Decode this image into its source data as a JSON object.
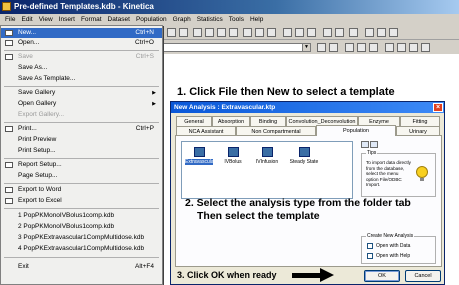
{
  "window": {
    "title": "Pre-defined Templates.kdb - Kinetica"
  },
  "menubar": [
    "File",
    "Edit",
    "View",
    "Insert",
    "Format",
    "Dataset",
    "Population",
    "Graph",
    "Statistics",
    "Tools",
    "Help"
  ],
  "file_menu": {
    "items": [
      {
        "label": "New...",
        "shortcut": "Ctrl+N",
        "selected": true
      },
      {
        "label": "Open...",
        "shortcut": "Ctrl+O"
      },
      {
        "label": "Save",
        "shortcut": "Ctrl+S",
        "disabled": true
      },
      {
        "label": "Save As..."
      },
      {
        "label": "Save As Template..."
      },
      {
        "label": "Save Gallery",
        "submenu": true
      },
      {
        "label": "Open Gallery",
        "submenu": true
      },
      {
        "label": "Export Gallery...",
        "disabled": true
      },
      {
        "label": "Print...",
        "shortcut": "Ctrl+P"
      },
      {
        "label": "Print Preview"
      },
      {
        "label": "Print Setup..."
      },
      {
        "label": "Report Setup..."
      },
      {
        "label": "Page Setup..."
      },
      {
        "label": "Export to Word"
      },
      {
        "label": "Export to Excel"
      },
      {
        "label": "1 PopPKMonoIVBolus1comp.kdb"
      },
      {
        "label": "2 PopPKMonoIVBolus1comp.kdb"
      },
      {
        "label": "3 PopPKExtravascular1CompMultidose.kdb"
      },
      {
        "label": "4 PopPKExtravascular1CompMultidose.kdb"
      },
      {
        "label": "Exit",
        "shortcut": "Alt+F4"
      }
    ]
  },
  "annotations": {
    "step1": "1. Click File then New to select a template",
    "step2_line1": "2. Select the analysis type from the folder tab",
    "step2_line2": "Then select the template",
    "step3": "3. Click OK when ready"
  },
  "dialog": {
    "title": "New Analysis : Extravascular.ktp",
    "tabs_row1": [
      "General",
      "Absorption",
      "Binding",
      "Convolution_Deconvolution",
      "Enzyme",
      "Fitting"
    ],
    "tabs_row2": [
      "NCA Assistant",
      "Non Compartmental",
      "Population",
      "Urinary"
    ],
    "active_tab": "Population",
    "templates": [
      {
        "label": "Extravascular",
        "selected": true
      },
      {
        "label": "IVBolus"
      },
      {
        "label": "IVInfusion"
      },
      {
        "label": "Steady State"
      }
    ],
    "tips": {
      "label": "Tips",
      "text": "To import data directly from the database, select the menu option File/ODBC Import."
    },
    "create_group": {
      "label": "Create New Analysis",
      "options": [
        "Open with Data",
        "Open with Help"
      ]
    },
    "buttons": {
      "ok": "OK",
      "cancel": "Cancel"
    }
  },
  "colors": {
    "title_bar": "#0a246a",
    "menu_highlight": "#316ac5",
    "dialog_title": "#0a58d8"
  }
}
